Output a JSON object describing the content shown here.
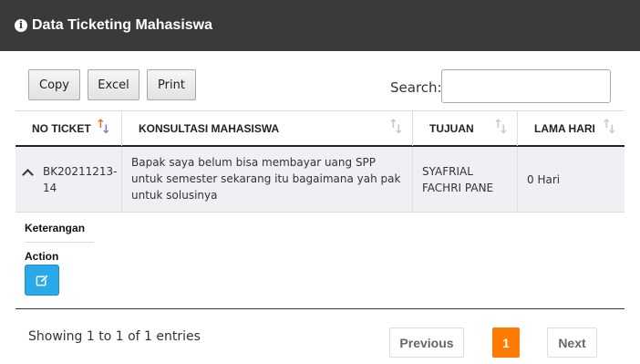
{
  "header": {
    "title": "Data Ticketing Mahasiswa",
    "icon": "info-icon"
  },
  "toolbar": {
    "copy_label": "Copy",
    "excel_label": "Excel",
    "print_label": "Print"
  },
  "search": {
    "label": "Search:",
    "value": ""
  },
  "table": {
    "columns": [
      "NO TICKET",
      "KONSULTASI MAHASISWA",
      "TUJUAN",
      "LAMA HARI"
    ],
    "sorted_column": "NO TICKET",
    "rows": [
      {
        "ticket": "BK20211213-14",
        "konsultasi": "Bapak saya belum bisa membayar uang SPP untuk semester sekarang itu bagaimana yah pak untuk solusinya",
        "tujuan": "SYAFRIAL FACHRI PANE",
        "lama": "0 Hari"
      }
    ],
    "detail": {
      "keterangan_label": "Keterangan",
      "action_label": "Action",
      "edit_icon": "edit-icon"
    }
  },
  "footer": {
    "info": "Showing 1 to 1 of 1 entries",
    "previous_label": "Previous",
    "current_page": "1",
    "next_label": "Next"
  },
  "colors": {
    "header_bg": "#3a3a3a",
    "active_page": "#ff7a00",
    "edit_button": "#29a9e8",
    "row_bg": "#eef0f3"
  }
}
